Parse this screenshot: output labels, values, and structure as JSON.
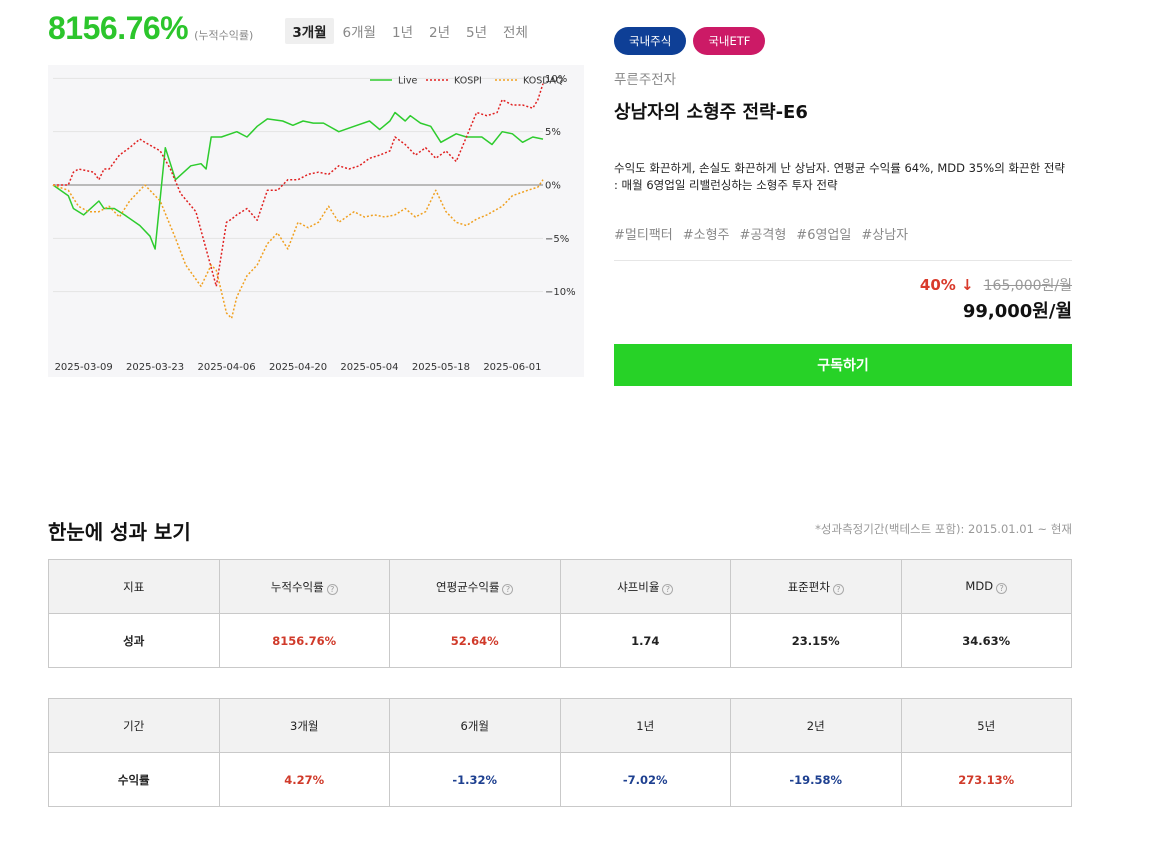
{
  "performance": {
    "value": "8156.76%",
    "label": "(누적수익률)",
    "periods": [
      "3개월",
      "6개월",
      "1년",
      "2년",
      "5년",
      "전체"
    ]
  },
  "chart_data": {
    "type": "line",
    "x": [
      "2025-03-03",
      "2025-03-09",
      "2025-03-23",
      "2025-04-06",
      "2025-04-20",
      "2025-05-04",
      "2025-05-18",
      "2025-06-01",
      "2025-06-07"
    ],
    "x_ticks": [
      "2025-03-09",
      "2025-03-23",
      "2025-04-06",
      "2025-04-20",
      "2025-05-04",
      "2025-05-18",
      "2025-06-01"
    ],
    "y_ticks": [
      "10%",
      "5%",
      "0%",
      "−5%",
      "−10%"
    ],
    "ylim": [
      -15,
      10.5
    ],
    "y_axis_side": "right",
    "legend_position": "top-right",
    "grid": true,
    "series": [
      {
        "name": "Live",
        "color": "#2ecc2e",
        "style": "solid",
        "x": [
          "2025-03-03",
          "2025-03-06",
          "2025-03-07",
          "2025-03-09",
          "2025-03-12",
          "2025-03-13",
          "2025-03-15",
          "2025-03-17",
          "2025-03-20",
          "2025-03-22",
          "2025-03-23",
          "2025-03-25",
          "2025-03-27",
          "2025-03-30",
          "2025-04-01",
          "2025-04-02",
          "2025-04-03",
          "2025-04-05",
          "2025-04-08",
          "2025-04-10",
          "2025-04-11",
          "2025-04-12",
          "2025-04-14",
          "2025-04-17",
          "2025-04-19",
          "2025-04-21",
          "2025-04-23",
          "2025-04-25",
          "2025-04-28",
          "2025-05-01",
          "2025-05-04",
          "2025-05-06",
          "2025-05-08",
          "2025-05-09",
          "2025-05-11",
          "2025-05-12",
          "2025-05-14",
          "2025-05-16",
          "2025-05-18",
          "2025-05-21",
          "2025-05-23",
          "2025-05-26",
          "2025-05-28",
          "2025-05-30",
          "2025-06-01",
          "2025-06-03",
          "2025-06-05",
          "2025-06-07"
        ],
        "values": [
          0,
          -1,
          -2.2,
          -2.8,
          -1.5,
          -2.2,
          -2.2,
          -2.8,
          -3.8,
          -4.8,
          -6,
          3.5,
          0.5,
          1.8,
          2,
          1.5,
          4.5,
          4.5,
          5,
          4.5,
          5,
          5.5,
          6.2,
          6,
          5.6,
          6,
          5.8,
          5.8,
          5,
          5.5,
          6,
          5.2,
          6,
          6.8,
          6,
          6.5,
          5.8,
          5.5,
          4,
          4.8,
          4.5,
          4.5,
          3.8,
          5,
          4.8,
          4,
          4.5,
          4.3
        ]
      },
      {
        "name": "KOSPI",
        "color": "#e02020",
        "style": "dotted",
        "x": [
          "2025-03-03",
          "2025-03-06",
          "2025-03-07",
          "2025-03-08",
          "2025-03-11",
          "2025-03-12",
          "2025-03-13",
          "2025-03-14",
          "2025-03-16",
          "2025-03-18",
          "2025-03-20",
          "2025-03-21",
          "2025-03-24",
          "2025-03-26",
          "2025-03-28",
          "2025-03-31",
          "2025-04-02",
          "2025-04-04",
          "2025-04-06",
          "2025-04-07",
          "2025-04-08",
          "2025-04-10",
          "2025-04-12",
          "2025-04-14",
          "2025-04-16",
          "2025-04-18",
          "2025-04-20",
          "2025-04-22",
          "2025-04-24",
          "2025-04-26",
          "2025-04-28",
          "2025-04-30",
          "2025-05-02",
          "2025-05-04",
          "2025-05-06",
          "2025-05-08",
          "2025-05-09",
          "2025-05-11",
          "2025-05-13",
          "2025-05-15",
          "2025-05-17",
          "2025-05-19",
          "2025-05-21",
          "2025-05-23",
          "2025-05-25",
          "2025-05-27",
          "2025-05-29",
          "2025-05-30",
          "2025-06-01",
          "2025-06-03",
          "2025-06-05",
          "2025-06-06",
          "2025-06-07"
        ],
        "values": [
          0,
          0,
          1.2,
          1.5,
          1.2,
          0.5,
          1.5,
          1.5,
          2.8,
          3.5,
          4.3,
          4,
          3.2,
          1.5,
          -0.8,
          -2.5,
          -6,
          -9.5,
          -3.5,
          -3.2,
          -2.8,
          -2.2,
          -3.3,
          -0.5,
          -0.5,
          0.5,
          0.5,
          1,
          1.2,
          1,
          1.8,
          1.5,
          1.8,
          2.5,
          2.8,
          3.2,
          4.5,
          3.8,
          2.8,
          3.5,
          2.5,
          3.2,
          2.2,
          4.5,
          6.8,
          6.5,
          6.8,
          8,
          7.5,
          7.5,
          7.2,
          8,
          9.5
        ]
      },
      {
        "name": "KOSDAQ",
        "color": "#f0a020",
        "style": "dotted",
        "x": [
          "2025-03-03",
          "2025-03-06",
          "2025-03-08",
          "2025-03-10",
          "2025-03-12",
          "2025-03-14",
          "2025-03-16",
          "2025-03-18",
          "2025-03-20",
          "2025-03-21",
          "2025-03-24",
          "2025-03-27",
          "2025-03-29",
          "2025-04-01",
          "2025-04-03",
          "2025-04-04",
          "2025-04-06",
          "2025-04-07",
          "2025-04-08",
          "2025-04-10",
          "2025-04-12",
          "2025-04-14",
          "2025-04-16",
          "2025-04-18",
          "2025-04-20",
          "2025-04-22",
          "2025-04-24",
          "2025-04-26",
          "2025-04-28",
          "2025-05-01",
          "2025-05-03",
          "2025-05-05",
          "2025-05-07",
          "2025-05-09",
          "2025-05-11",
          "2025-05-13",
          "2025-05-15",
          "2025-05-17",
          "2025-05-19",
          "2025-05-21",
          "2025-05-23",
          "2025-05-25",
          "2025-05-27",
          "2025-05-30",
          "2025-06-01",
          "2025-06-04",
          "2025-06-06",
          "2025-06-07"
        ],
        "values": [
          0,
          -0.5,
          -2,
          -2.5,
          -2.5,
          -2,
          -3,
          -1.5,
          -0.5,
          0,
          -1.5,
          -5,
          -7.5,
          -9.5,
          -7.5,
          -8,
          -12,
          -12.5,
          -10.5,
          -8.5,
          -7.5,
          -5.5,
          -4.5,
          -6,
          -3.5,
          -4,
          -3.5,
          -2,
          -3.5,
          -2.5,
          -3,
          -2.8,
          -3,
          -2.8,
          -2.2,
          -3,
          -2.5,
          -0.5,
          -2.5,
          -3.5,
          -3.8,
          -3.2,
          -2.8,
          -2,
          -1,
          -0.5,
          -0.2,
          0.5
        ]
      }
    ]
  },
  "tags": [
    {
      "label": "국내주식",
      "color": "#0e3f96"
    },
    {
      "label": "국내ETF",
      "color": "#cc1a66"
    }
  ],
  "company": "푸른주전자",
  "strategy_title": "상남자의 소형주 전략-E6",
  "description": "수익도 화끈하게, 손실도 화끈하게 난 상남자. 연평균 수익률 64%, MDD 35%의 화끈한 전략 : 매월 6영업일 리밸런싱하는 소형주 투자 전략",
  "hashtags": [
    "#멀티팩터",
    "#소형주",
    "#공격형",
    "#6영업일",
    "#상남자"
  ],
  "pricing": {
    "discount": "40%",
    "discount_arrow": "↓",
    "original_price": "165,000원/월",
    "final_price": "99,000원/월"
  },
  "subscribe_label": "구독하기",
  "section": {
    "title": "한눈에 성과 보기",
    "note": "*성과측정기간(백테스트 포함): 2015.01.01 ~ 현재"
  },
  "metrics_table": {
    "headers": [
      "지표",
      "누적수익률",
      "연평균수익률",
      "샤프비율",
      "표준편차",
      "MDD"
    ],
    "row_label": "성과",
    "values": [
      "8156.76%",
      "52.64%",
      "1.74",
      "23.15%",
      "34.63%"
    ],
    "help_icon_glyph": "?"
  },
  "period_table": {
    "headers": [
      "기간",
      "3개월",
      "6개월",
      "1년",
      "2년",
      "5년"
    ],
    "row_label": "수익률",
    "values": [
      "4.27%",
      "-1.32%",
      "-7.02%",
      "-19.58%",
      "273.13%"
    ]
  }
}
